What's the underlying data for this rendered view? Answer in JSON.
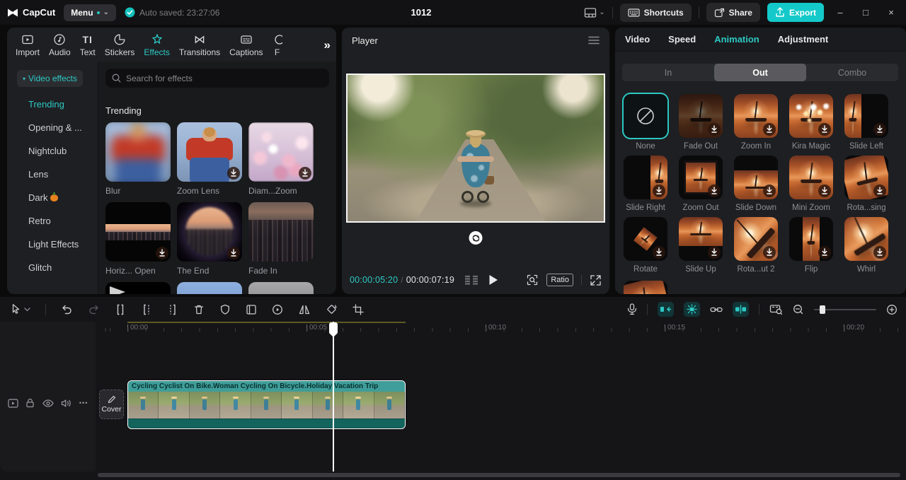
{
  "topbar": {
    "app_name": "CapCut",
    "menu_label": "Menu",
    "autosave_text": "Auto saved: 23:27:06",
    "project_title": "1012",
    "shortcuts_label": "Shortcuts",
    "share_label": "Share",
    "export_label": "Export"
  },
  "left_panel": {
    "tabs": [
      {
        "label": "Import"
      },
      {
        "label": "Audio"
      },
      {
        "label": "Text"
      },
      {
        "label": "Stickers"
      },
      {
        "label": "Effects",
        "active": true
      },
      {
        "label": "Transitions"
      },
      {
        "label": "Captions"
      },
      {
        "label": "F",
        "truncated": true
      }
    ],
    "sidebar": {
      "header": "Video effects",
      "items": [
        {
          "label": "Trending",
          "active": true
        },
        {
          "label": "Opening & ..."
        },
        {
          "label": "Nightclub"
        },
        {
          "label": "Lens"
        },
        {
          "label": "Dark",
          "emoji": "pumpkin"
        },
        {
          "label": "Retro"
        },
        {
          "label": "Light Effects"
        },
        {
          "label": "Glitch"
        }
      ]
    },
    "search_placeholder": "Search for effects",
    "section_title": "Trending",
    "effects": [
      {
        "label": "Blur",
        "download": false
      },
      {
        "label": "Zoom Lens",
        "download": true
      },
      {
        "label": "Diam...Zoom",
        "download": true
      },
      {
        "label": "Horiz... Open",
        "download": true
      },
      {
        "label": "The End",
        "download": true
      },
      {
        "label": "Fade In",
        "download": false
      }
    ]
  },
  "player": {
    "title": "Player",
    "current_time": "00:00:05:20",
    "time_separator": "/",
    "duration": "00:00:07:19",
    "ratio_label": "Ratio"
  },
  "right_panel": {
    "tabs": [
      {
        "label": "Video"
      },
      {
        "label": "Speed"
      },
      {
        "label": "Animation",
        "active": true
      },
      {
        "label": "Adjustment"
      }
    ],
    "segments": [
      {
        "label": "In"
      },
      {
        "label": "Out",
        "active": true
      },
      {
        "label": "Combo"
      }
    ],
    "animations": [
      {
        "label": "None",
        "selected": true,
        "download": false
      },
      {
        "label": "Fade Out",
        "download": true
      },
      {
        "label": "Zoom In",
        "download": true
      },
      {
        "label": "Kira Magic",
        "download": true
      },
      {
        "label": "Slide Left",
        "download": true
      },
      {
        "label": "Slide Right",
        "download": true
      },
      {
        "label": "Zoom Out",
        "download": true
      },
      {
        "label": "Slide Down",
        "download": true
      },
      {
        "label": "Mini Zoom",
        "download": true
      },
      {
        "label": "Rota...sing",
        "download": true
      },
      {
        "label": "Rotate",
        "download": true
      },
      {
        "label": "Slide Up",
        "download": true
      },
      {
        "label": "Rota...ut 2",
        "download": true
      },
      {
        "label": "Flip",
        "download": true
      },
      {
        "label": "Whirl",
        "download": true
      }
    ]
  },
  "timeline": {
    "ruler_labels": [
      "00:00",
      "00:05",
      "00:10",
      "00:15",
      "00:20"
    ],
    "cover_label": "Cover",
    "clip_title": "Cycling Cyclist On Bike.Woman Cycling On Bicycle.Holiday Vacation Trip",
    "track_more": "•••"
  },
  "icons": {
    "menu_chevron": "⌄",
    "more_tabs": "»",
    "text_tab_glyph": "TI",
    "transitions_glyph": "⋈",
    "window_min": "–",
    "window_max": "□",
    "window_close": "×"
  },
  "colors": {
    "accent_teal": "#2cc9c4",
    "export_button": "#14c9c9",
    "clip_titlebar": "#3f9e99",
    "clip_strip": "#14645e",
    "selected_border": "#2bc8c3"
  }
}
